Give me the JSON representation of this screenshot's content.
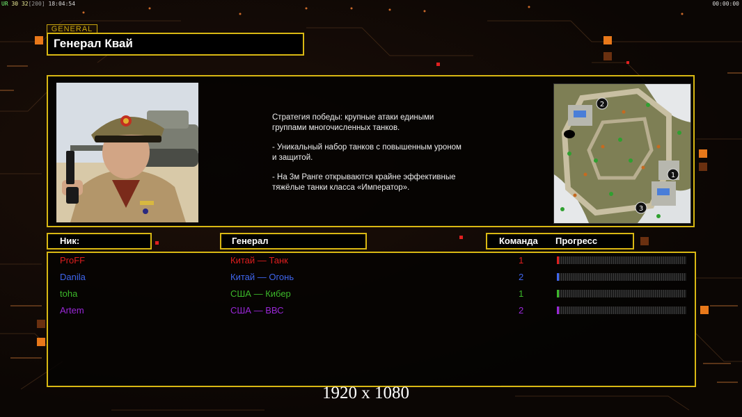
{
  "hud": {
    "left_ur": "UR",
    "left_a": "30",
    "left_b": "32",
    "left_c": "[200]",
    "left_time": "18:04:54",
    "right_time": "00:00:00"
  },
  "general": {
    "tag": "GENERAL",
    "name": "Генерал Квай",
    "description": [
      "Стратегия победы: крупные атаки едиными\n группами многочисленных танков.",
      "- Уникальный набор танков с повышенным уроном\n и защитой.",
      "- На 3м Ранге открываются крайне эффективные\n тяжёлые танки класса «Император»."
    ]
  },
  "map": {
    "start_positions": [
      "1",
      "2",
      "3"
    ]
  },
  "headers": {
    "nick": "Ник:",
    "general": "Генерал",
    "team": "Команда",
    "progress": "Прогресс"
  },
  "players": [
    {
      "nick": "ProFF",
      "general": "Китай — Танк",
      "team": "1",
      "color": "#e01e1e",
      "progress": 0.015
    },
    {
      "nick": "Danila",
      "general": "Китай — Огонь",
      "team": "2",
      "color": "#3f66ee",
      "progress": 0.01
    },
    {
      "nick": "toha",
      "general": "США — Кибер",
      "team": "1",
      "color": "#3cb82a",
      "progress": 0.01
    },
    {
      "nick": "Artem",
      "general": "США — ВВС",
      "team": "2",
      "color": "#9a27d8",
      "progress": 0.01
    }
  ],
  "footer": {
    "resolution": "1920 x 1080"
  }
}
